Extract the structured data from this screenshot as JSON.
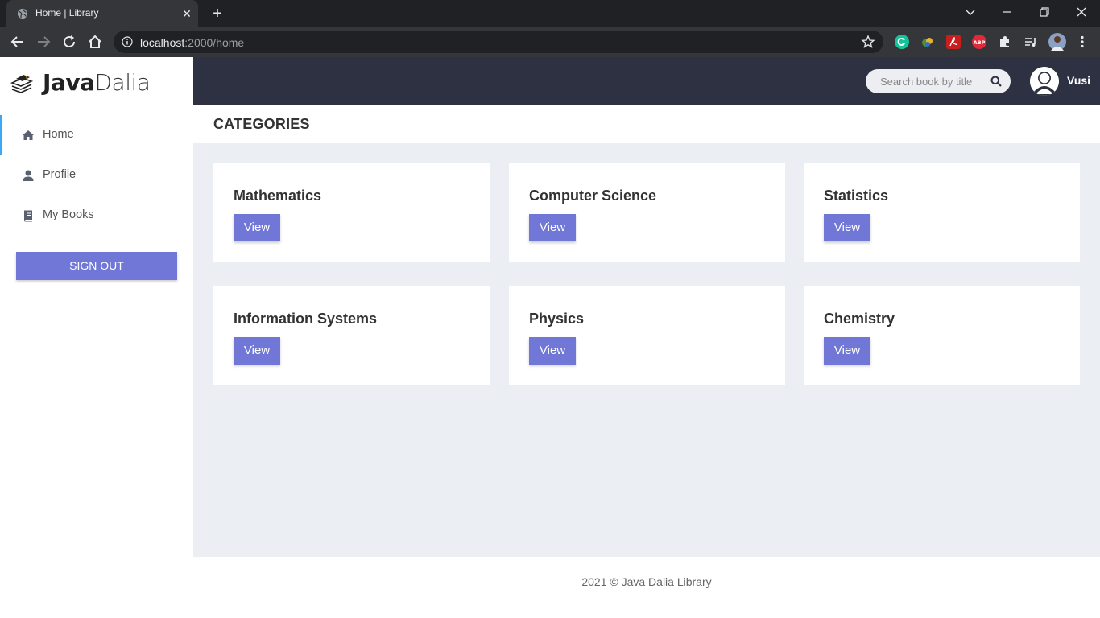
{
  "browser": {
    "tab_title": "Home | Library",
    "new_tab_symbol": "+",
    "close_symbol": "✕",
    "url_host": "localhost",
    "url_rest": ":2000/home"
  },
  "brand": {
    "name_bold": "Java",
    "name_light": "Dalia"
  },
  "sidebar": {
    "items": [
      {
        "label": "Home",
        "icon": "home-icon",
        "active": true
      },
      {
        "label": "Profile",
        "icon": "user-icon",
        "active": false
      },
      {
        "label": "My Books",
        "icon": "book-icon",
        "active": false
      }
    ],
    "signout_label": "SIGN OUT"
  },
  "topbar": {
    "search_placeholder": "Search book by title",
    "user_name": "Vusi"
  },
  "page": {
    "title": "CATEGORIES"
  },
  "categories": [
    {
      "name": "Mathematics",
      "button": "View"
    },
    {
      "name": "Computer Science",
      "button": "View"
    },
    {
      "name": "Statistics",
      "button": "View"
    },
    {
      "name": "Information Systems",
      "button": "View"
    },
    {
      "name": "Physics",
      "button": "View"
    },
    {
      "name": "Chemistry",
      "button": "View"
    }
  ],
  "footer": {
    "text": "2021 © Java Dalia Library"
  },
  "colors": {
    "accent": "#7077d6",
    "topbar": "#2e3142",
    "content_bg": "#ebeef3",
    "active_indicator": "#3aa8f5"
  }
}
